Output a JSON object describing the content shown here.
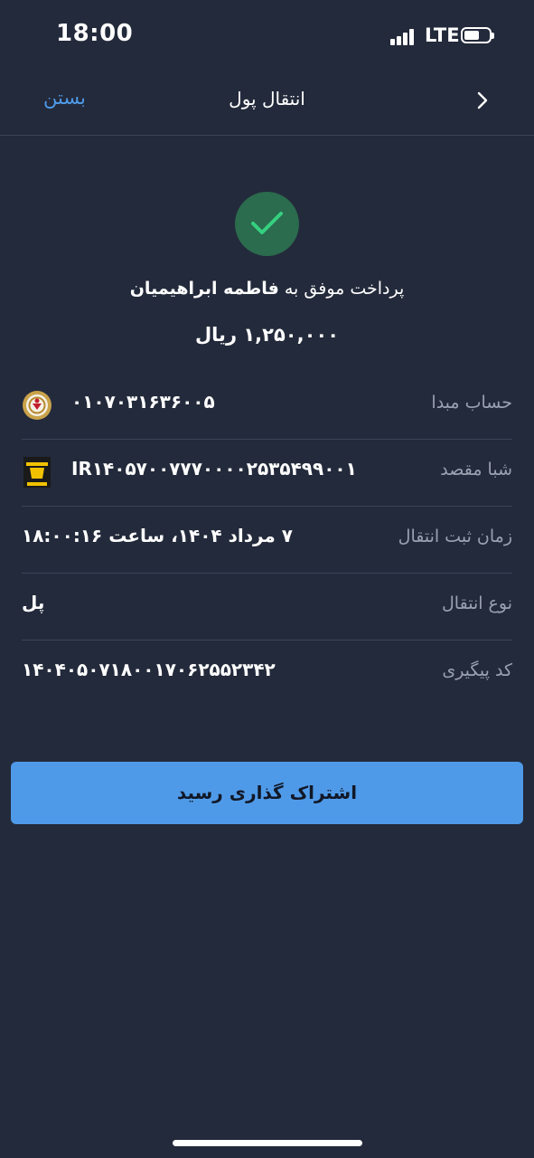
{
  "status": {
    "time": "18:00",
    "network": "LTE"
  },
  "nav": {
    "close_label": "بستن",
    "title": "انتقال پول"
  },
  "receipt": {
    "success_prefix": "پرداخت موفق به",
    "recipient": "فاطمه ابراهیمیان",
    "amount": "۱,۲۵۰,۰۰۰ ریال",
    "rows": [
      {
        "label": "حساب مبدا",
        "value": "۰۱۰۷۰۳۱۶۳۶۰۰۵",
        "logo": "bank-melli-logo"
      },
      {
        "label": "شبا مقصد",
        "value": "IR۱۴۰۵۷۰۰۷۷۷۰۰۰۰۲۵۳۵۴۹۹۰۰۱",
        "logo": "bank-saderat-logo"
      },
      {
        "label": "زمان ثبت انتقال",
        "value": "۷ مرداد ۱۴۰۴، ساعت ۱۸:۰۰:۱۶"
      },
      {
        "label": "نوع انتقال",
        "value": "پل"
      },
      {
        "label": "کد پیگیری",
        "value": "۱۴۰۴۰۵۰۷۱۸۰۰۱۷۰۶۲۵۵۲۳۴۲"
      }
    ]
  },
  "share_button": "اشتراک گذاری رسید",
  "colors": {
    "background": "#232a3b",
    "accent": "#4f9ae8",
    "success": "#2b6b4e",
    "check": "#35d07f"
  }
}
